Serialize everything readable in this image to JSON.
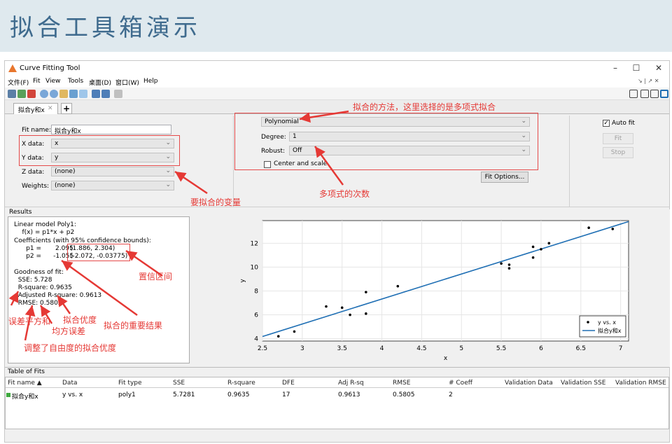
{
  "slide": {
    "title": "拟合工具箱演示"
  },
  "window": {
    "title": "Curve Fitting Tool",
    "minimize": "–",
    "maximize": "☐",
    "close": "✕"
  },
  "menu": {
    "items": [
      "文件(F)",
      "Fit",
      "View",
      "Tools",
      "桌面(D)",
      "窗口(W)",
      "Help"
    ],
    "right": "↘ | ↗ ✕"
  },
  "tab": {
    "label": "拟合y和x",
    "close": "✕",
    "add": "+"
  },
  "fitname": {
    "label": "Fit name:",
    "value": "拟合y和x"
  },
  "xdata": {
    "label": "X data:",
    "value": "x"
  },
  "ydata": {
    "label": "Y data:",
    "value": "y"
  },
  "zdata": {
    "label": "Z data:",
    "value": "(none)"
  },
  "weights": {
    "label": "Weights:",
    "value": "(none)"
  },
  "method": {
    "value": "Polynomial"
  },
  "degree": {
    "label": "Degree:",
    "value": "1"
  },
  "robust": {
    "label": "Robust:",
    "value": "Off"
  },
  "center": {
    "label": "Center and scale"
  },
  "fitoptions": {
    "label": "Fit Options..."
  },
  "autofit": {
    "label": "Auto fit"
  },
  "fitbtn": {
    "label": "Fit"
  },
  "stopbtn": {
    "label": "Stop"
  },
  "results": {
    "heading": "Results",
    "lines": [
      "Linear model Poly1:",
      "    f(x) = p1*x + p2",
      "Coefficients (with 95% confidence bounds):",
      "      p1 =       2.095",
      "      p2 =      -1.055",
      "",
      "Goodness of fit:",
      "  SSE: 5.728",
      "  R-square: 0.9635",
      "  Adjusted R-square: 0.9613",
      "  RMSE: 0.5805"
    ],
    "p1_ci": "(1.886, 2.304)",
    "p2_ci": "(-2.072, -0.03775)"
  },
  "annotations": {
    "method": "拟合的方法，这里选择的是多项式拟合",
    "degree": "多项式的次数",
    "vars": "要拟合的变量",
    "ci": "置信区间",
    "sse": "误差平方和",
    "rsq": "拟合优度",
    "rmse": "均方误差",
    "important": "拟合的重要结果",
    "adjrsq": "调整了自由度的拟合优度"
  },
  "chart_data": {
    "type": "scatter",
    "xlabel": "x",
    "ylabel": "y",
    "xlim": [
      2.5,
      7.1
    ],
    "ylim": [
      3.8,
      13.9
    ],
    "xticks": [
      "2.5",
      "3",
      "3.5",
      "4",
      "4.5",
      "5",
      "5.5",
      "6",
      "6.5",
      "7"
    ],
    "yticks": [
      "4",
      "6",
      "8",
      "10",
      "12"
    ],
    "grid": true,
    "legend_position": "bottom-right",
    "series": [
      {
        "name": "y vs. x",
        "kind": "points",
        "color": "#000000",
        "x": [
          2.7,
          2.9,
          3.3,
          3.5,
          3.6,
          3.8,
          3.8,
          4.2,
          5.5,
          5.6,
          5.6,
          5.9,
          5.9,
          6.0,
          6.1,
          6.6,
          6.9
        ],
        "y": [
          4.2,
          4.6,
          6.7,
          6.6,
          6.0,
          6.1,
          7.9,
          8.4,
          10.3,
          10.2,
          9.9,
          11.7,
          10.8,
          11.5,
          12.0,
          13.3,
          13.2
        ]
      },
      {
        "name": "拟合y和x",
        "kind": "line",
        "color": "#1f6fb4",
        "p1": 2.095,
        "p2": -1.055
      }
    ]
  },
  "table": {
    "title": "Table of Fits",
    "columns": [
      "Fit name ▲",
      "Data",
      "Fit type",
      "SSE",
      "R-square",
      "DFE",
      "Adj R-sq",
      "RMSE",
      "# Coeff",
      "Validation Data",
      "Validation SSE",
      "Validation RMSE"
    ],
    "row": [
      "拟合y和x",
      "y vs. x",
      "poly1",
      "5.7281",
      "0.9635",
      "17",
      "0.9613",
      "0.5805",
      "2",
      "",
      "",
      ""
    ]
  },
  "colors": {
    "accent": "#e53935",
    "fitline": "#1f6fb4",
    "header": "#3f6b8e"
  }
}
